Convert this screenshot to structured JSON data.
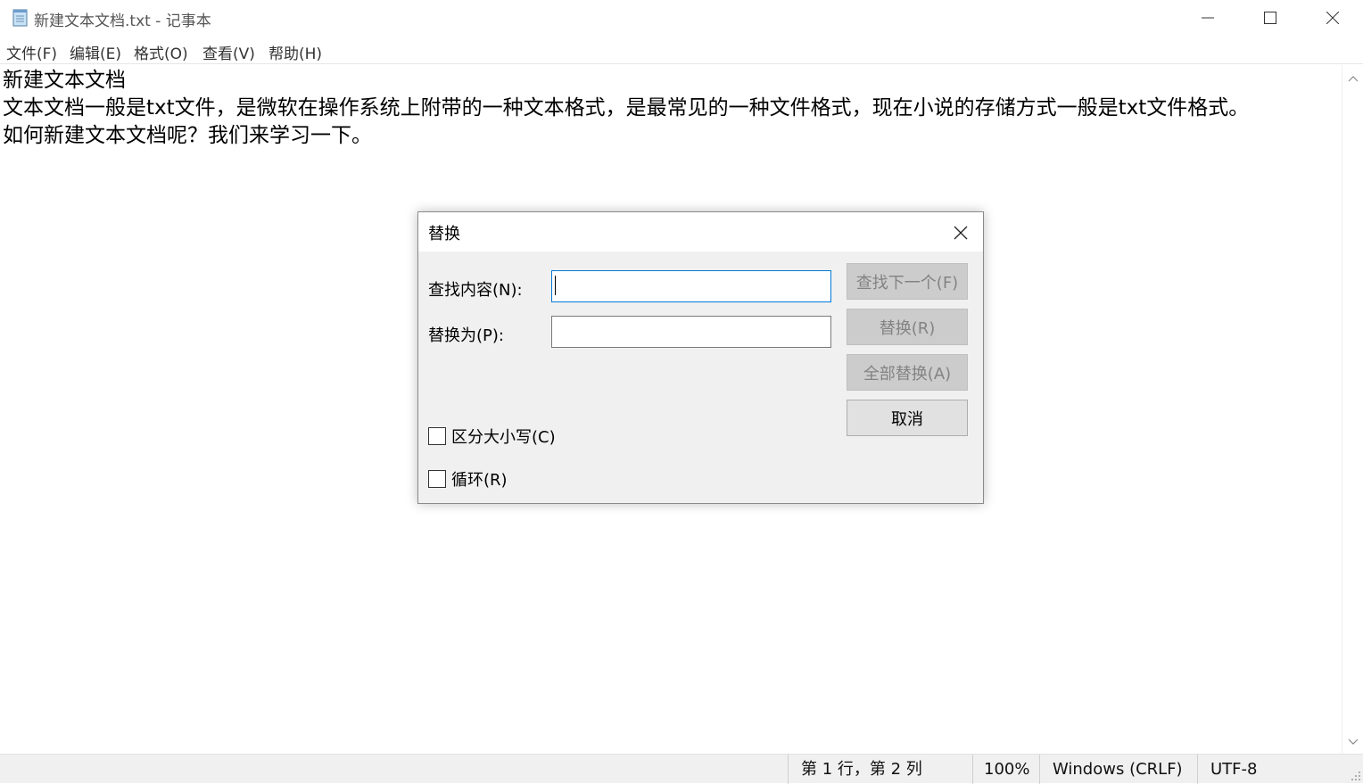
{
  "window": {
    "title": "新建文本文档.txt - 记事本",
    "icons": {
      "app": "notepad-icon",
      "minimize": "minimize-icon",
      "maximize": "maximize-icon",
      "close": "close-icon"
    }
  },
  "menu": {
    "items": [
      {
        "label": "文件(F)"
      },
      {
        "label": "编辑(E)"
      },
      {
        "label": "格式(O)"
      },
      {
        "label": "查看(V)"
      },
      {
        "label": "帮助(H)"
      }
    ]
  },
  "editor": {
    "lines": [
      "新建文本文档",
      "文本文档一般是txt文件，是微软在操作系统上附带的一种文本格式，是最常见的一种文件格式，现在小说的存储方式一般是txt文件格式。",
      "如何新建文本文档呢？我们来学习一下。"
    ]
  },
  "dialog": {
    "title": "替换",
    "find_label": "查找内容(N):",
    "find_value": "",
    "replace_label": "替换为(P):",
    "replace_value": "",
    "buttons": {
      "find_next": "查找下一个(F)",
      "replace": "替换(R)",
      "replace_all": "全部替换(A)",
      "cancel": "取消"
    },
    "options": {
      "match_case": {
        "label": "区分大小写(C)",
        "checked": false
      },
      "wrap_around": {
        "label": "循环(R)",
        "checked": false
      }
    }
  },
  "status": {
    "position": "第 1 行，第 2 列",
    "zoom": "100%",
    "line_ending": "Windows (CRLF)",
    "encoding": "UTF-8"
  },
  "colors": {
    "accent": "#0078d7",
    "dialog_bg": "#f0f0f0",
    "disabled_text": "#838383"
  }
}
